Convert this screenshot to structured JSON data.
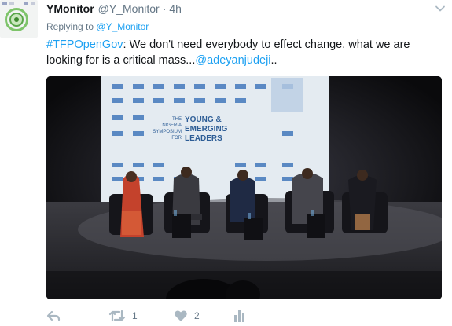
{
  "tweet": {
    "author_name": "YMonitor",
    "author_handle": "@Y_Monitor",
    "separator": "·",
    "time": "4h",
    "replying_prefix": "Replying to",
    "replying_handle": "@Y_Monitor",
    "hashtag": "#TFPOpenGov",
    "text_body": ": We don't need everybody to effect change, what we are looking for is a critical mass...",
    "mention": "@adeyanjudeji",
    "text_end": "..",
    "banner_lines": [
      "THE",
      "NIGERIA",
      "SYMPOSIUM",
      "FOR"
    ],
    "banner_title": [
      "YOUNG &",
      "EMERGING",
      "LEADERS"
    ]
  },
  "actions": {
    "reply_icon": "reply-icon",
    "retweet_icon": "retweet-icon",
    "retweet_count": "1",
    "like_icon": "heart-icon",
    "like_count": "2",
    "analytics_icon": "analytics-icon"
  },
  "colors": {
    "link": "#1da1f2",
    "muted": "#657786",
    "icon": "#aab8c2",
    "text": "#14171a"
  }
}
